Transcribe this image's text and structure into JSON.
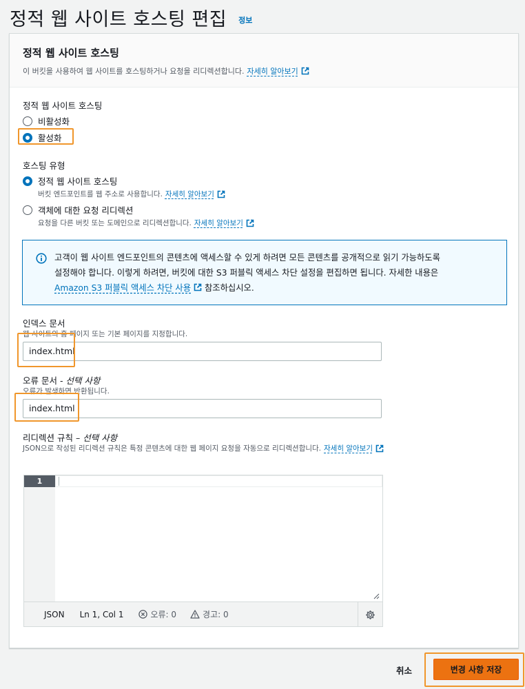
{
  "page": {
    "title": "정적 웹 사이트 호스팅 편집",
    "info_link": "정보"
  },
  "panel": {
    "title": "정적 웹 사이트 호스팅",
    "description": "이 버킷을 사용하여 웹 사이트를 호스팅하거나 요청을 리디렉션합니다.",
    "learn_more": "자세히 알아보기"
  },
  "hosting": {
    "label": "정적 웹 사이트 호스팅",
    "options": [
      {
        "label": "비활성화",
        "selected": false
      },
      {
        "label": "활성화",
        "selected": true
      }
    ]
  },
  "hosting_type": {
    "label": "호스팅 유형",
    "options": [
      {
        "label": "정적 웹 사이트 호스팅",
        "description": "버킷 엔드포인트를 웹 주소로 사용합니다.",
        "learn_more": "자세히 알아보기",
        "selected": true
      },
      {
        "label": "객체에 대한 요청 리디렉션",
        "description": "요청을 다른 버킷 또는 도메인으로 리디렉션합니다.",
        "learn_more": "자세히 알아보기",
        "selected": false
      }
    ]
  },
  "alert": {
    "line1": "고객이 웹 사이트 엔드포인트의 콘텐츠에 액세스할 수 있게 하려면 모든 콘텐츠를 공개적으로 읽기 가능하도록",
    "line2": "설정해야 합니다. 이렇게 하려면, 버킷에 대한 S3 퍼블릭 액세스 차단 설정을 편집하면 됩니다. 자세한 내용은",
    "link": "Amazon S3 퍼블릭 액세스 차단 사용",
    "suffix": "참조하십시오."
  },
  "index_document": {
    "label": "인덱스 문서",
    "description": "웹 사이트의 홈 페이지 또는 기본 페이지를 지정합니다.",
    "value": "index.html"
  },
  "error_document": {
    "label": "오류 문서",
    "optional": "선택 사항",
    "separator": " - ",
    "description": "오류가 발생하면 반환됩니다.",
    "value": "index.html"
  },
  "redirect_rules": {
    "label": "리디렉션 규칙",
    "separator": " – ",
    "optional": "선택 사항",
    "description": "JSON으로 작성된 리디렉션 규칙은 특정 콘텐츠에 대한 웹 페이지 요청을 자동으로 리디렉션합니다.",
    "learn_more": "자세히 알아보기"
  },
  "editor": {
    "line_number": "1",
    "language": "JSON",
    "position": "Ln 1, Col 1",
    "errors": "오류: 0",
    "warnings": "경고: 0"
  },
  "footer": {
    "cancel": "취소",
    "save": "변경 사항 저장"
  },
  "colors": {
    "link": "#0073bb",
    "primary_button": "#ec7211",
    "highlight": "#f0962b"
  }
}
